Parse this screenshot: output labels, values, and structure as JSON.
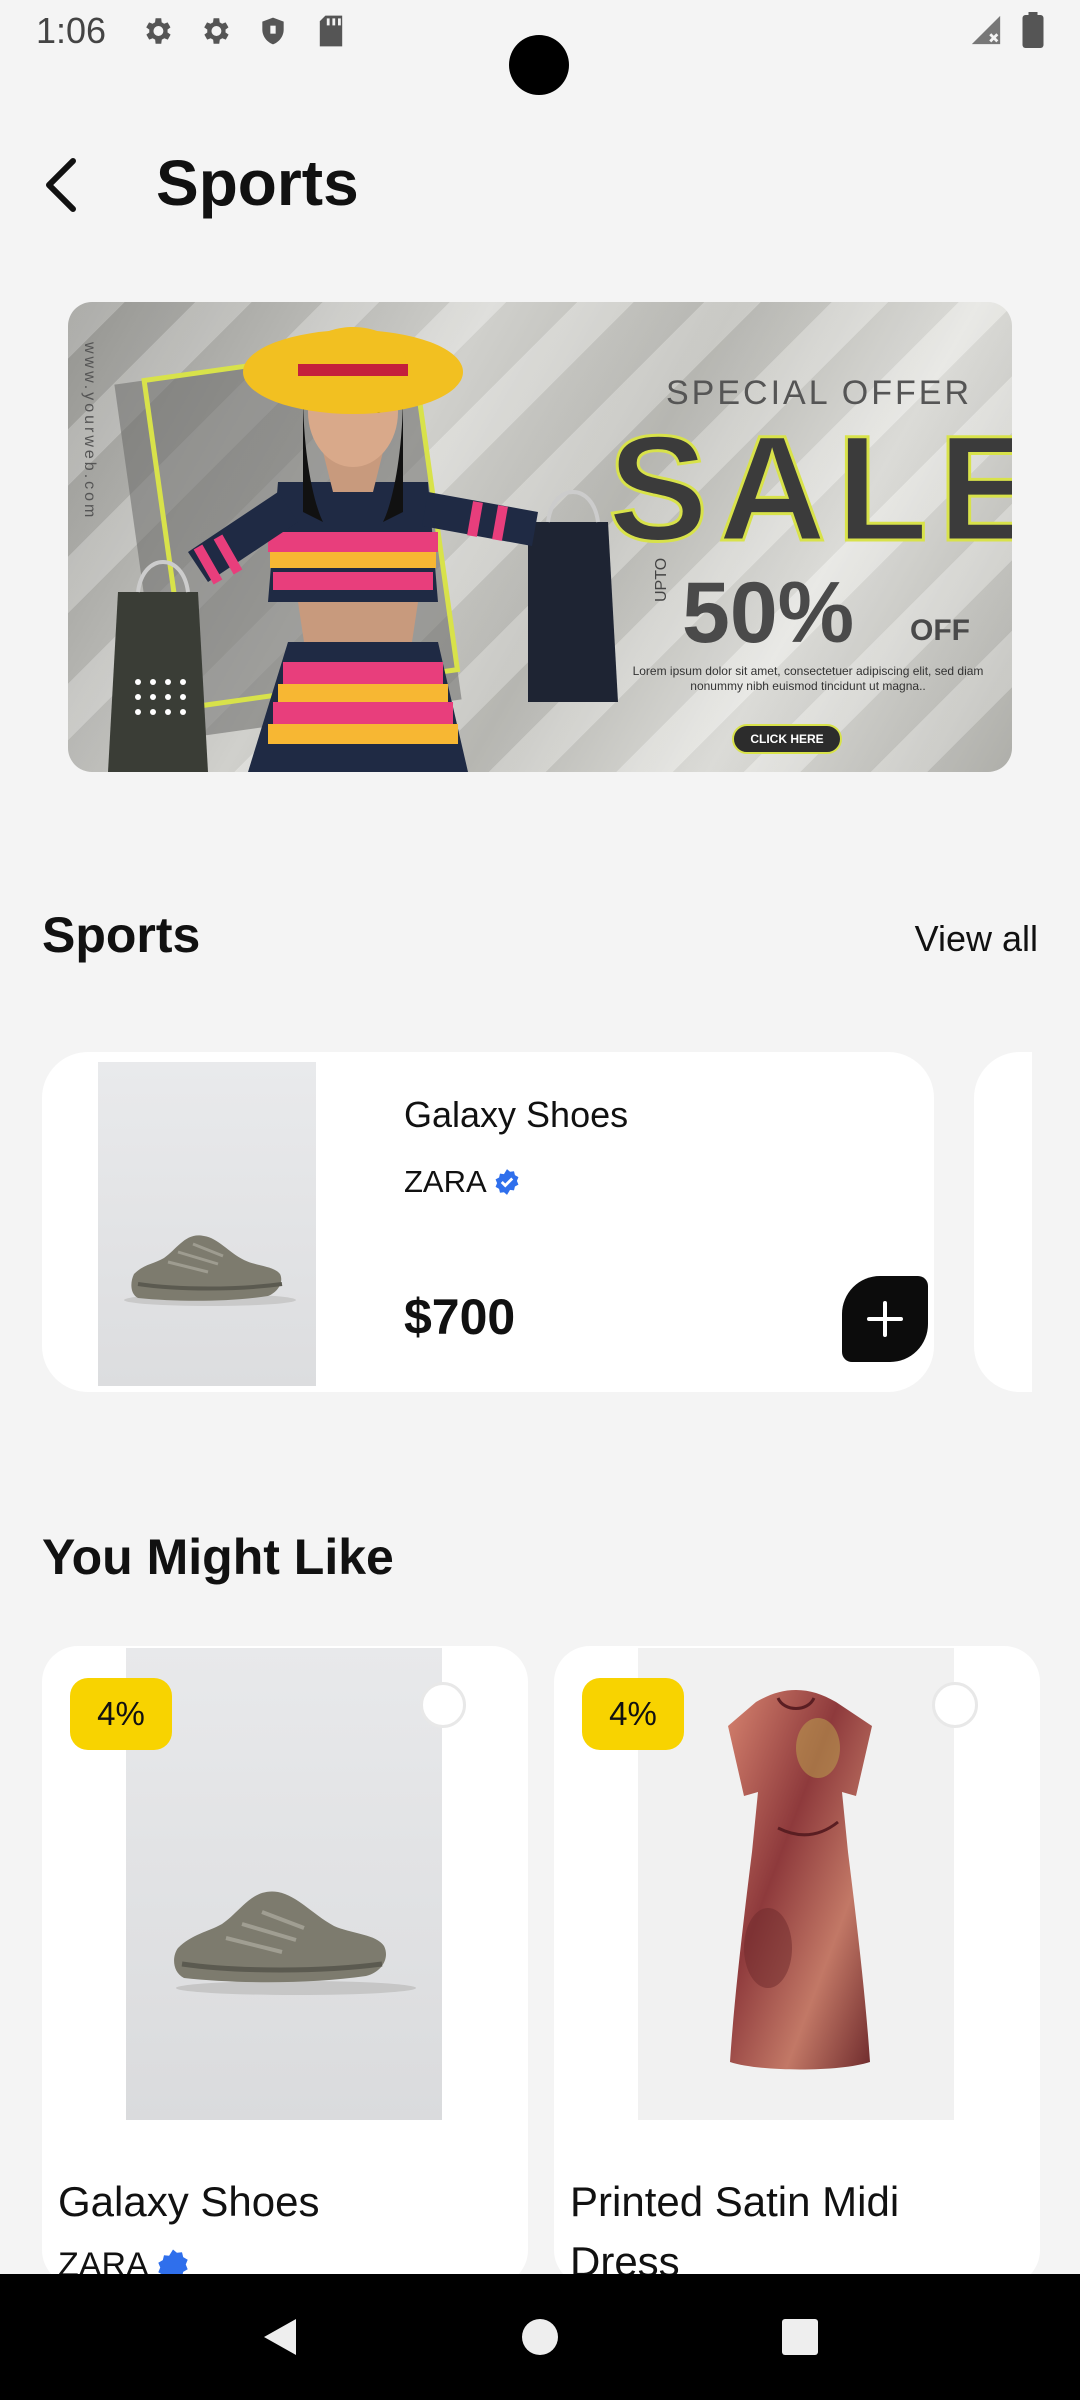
{
  "status_bar": {
    "time": "1:06",
    "left_icons": [
      "gear-icon",
      "gear-icon",
      "shield-icon",
      "sd-card-icon"
    ],
    "right_icons": [
      "signal-icon",
      "battery-icon"
    ]
  },
  "header": {
    "back_icon": "chevron-left-icon",
    "title": "Sports"
  },
  "banner": {
    "url_text": "www.yourweb.com",
    "special_offer": "SPECIAL OFFER",
    "sale": "SALE",
    "upto": "UPTO",
    "percent": "50%",
    "off": "OFF",
    "lorem": "Lorem ipsum dolor sit amet, consectetuer adipiscing elit, sed diam nonummy nibh euismod tincidunt ut magna..",
    "cta": "CLICK HERE"
  },
  "sports_section": {
    "title": "Sports",
    "view_all": "View all",
    "product": {
      "name": "Galaxy Shoes",
      "brand": "ZARA",
      "price": "$700",
      "verified_icon": "verified-badge-icon",
      "add_icon": "plus-icon"
    }
  },
  "you_might_like": {
    "title": "You Might Like",
    "items": [
      {
        "discount": "4%",
        "name": "Galaxy Shoes",
        "brand": "ZARA"
      },
      {
        "discount": "4%",
        "name": " Printed Satin Midi Dress",
        "brand": ""
      }
    ]
  },
  "nav_bar": {
    "icons": [
      "back-triangle-icon",
      "home-circle-icon",
      "recents-square-icon"
    ]
  },
  "colors": {
    "background": "#f4f4f4",
    "discount_badge": "#f8d300",
    "verified": "#2f6fec",
    "add_button": "#0c0c0c"
  }
}
